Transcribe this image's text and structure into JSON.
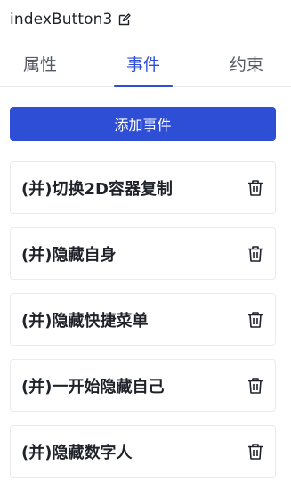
{
  "header": {
    "title": "indexButton3",
    "edit_icon": "edit-icon"
  },
  "tabs": [
    {
      "label": "属性",
      "active": false
    },
    {
      "label": "事件",
      "active": true
    },
    {
      "label": "约束",
      "active": false
    }
  ],
  "colors": {
    "accent": "#2f4ed6",
    "text": "#1f2329",
    "border": "#ebebeb"
  },
  "add_button": {
    "label": "添加事件"
  },
  "events": [
    {
      "label": "(并)切换2D容器复制",
      "delete_icon": "trash-icon"
    },
    {
      "label": "(并)隐藏自身",
      "delete_icon": "trash-icon"
    },
    {
      "label": "(并)隐藏快捷菜单",
      "delete_icon": "trash-icon"
    },
    {
      "label": "(并)一开始隐藏自己",
      "delete_icon": "trash-icon"
    },
    {
      "label": "(并)隐藏数字人",
      "delete_icon": "trash-icon"
    }
  ]
}
